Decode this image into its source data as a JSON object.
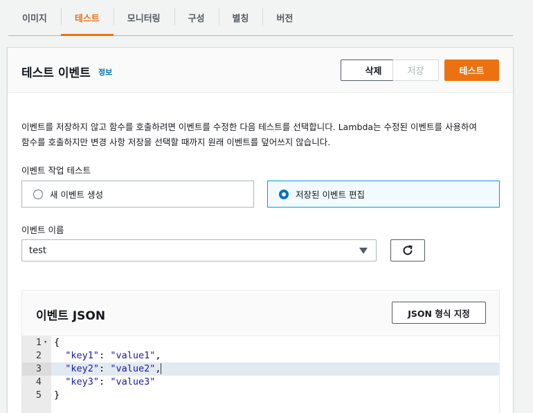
{
  "tabs": [
    {
      "label": "이미지",
      "active": false
    },
    {
      "label": "테스트",
      "active": true
    },
    {
      "label": "모니터링",
      "active": false
    },
    {
      "label": "구성",
      "active": false
    },
    {
      "label": "별칭",
      "active": false
    },
    {
      "label": "버전",
      "active": false
    }
  ],
  "panel": {
    "title": "테스트 이벤트",
    "info_link": "정보",
    "delete_label": "삭제",
    "save_label": "저장",
    "test_label": "테스트",
    "description_line1": "이벤트를 저장하지 않고 함수를 호출하려면 이벤트를 수정한 다음 테스트를 선택합니다. Lambda는 수정된 이벤트를 사용하여",
    "description_line2": "함수를 호출하지만 변경 사항 저장을 선택할 때까지 원래 이벤트를 덮어쓰지 않습니다.",
    "action_label": "이벤트 작업 테스트",
    "option_new": "새 이벤트 생성",
    "option_edit": "저장된 이벤트 편집",
    "selected_option": "option_edit",
    "event_name_label": "이벤트 이름",
    "event_name_value": "test"
  },
  "json_section": {
    "title": "이벤트 JSON",
    "format_button": "JSON 형식 지정",
    "active_line": 3,
    "lines": [
      {
        "number": "1",
        "text": "{"
      },
      {
        "number": "2",
        "key": "\"key1\"",
        "value": "\"value1\"",
        "suffix": ","
      },
      {
        "number": "3",
        "key": "\"key2\"",
        "value": "\"value2\"",
        "suffix": ","
      },
      {
        "number": "4",
        "key": "\"key3\"",
        "value": "\"value3\"",
        "suffix": ""
      },
      {
        "number": "5",
        "text": "}"
      }
    ]
  },
  "colors": {
    "accent": "#ec7211",
    "link": "#0073bb",
    "selected_border": "#00a1c9"
  },
  "icons": {
    "refresh": "refresh-icon",
    "dropdown": "caret-down-icon",
    "fold": "fold-arrow-icon"
  }
}
